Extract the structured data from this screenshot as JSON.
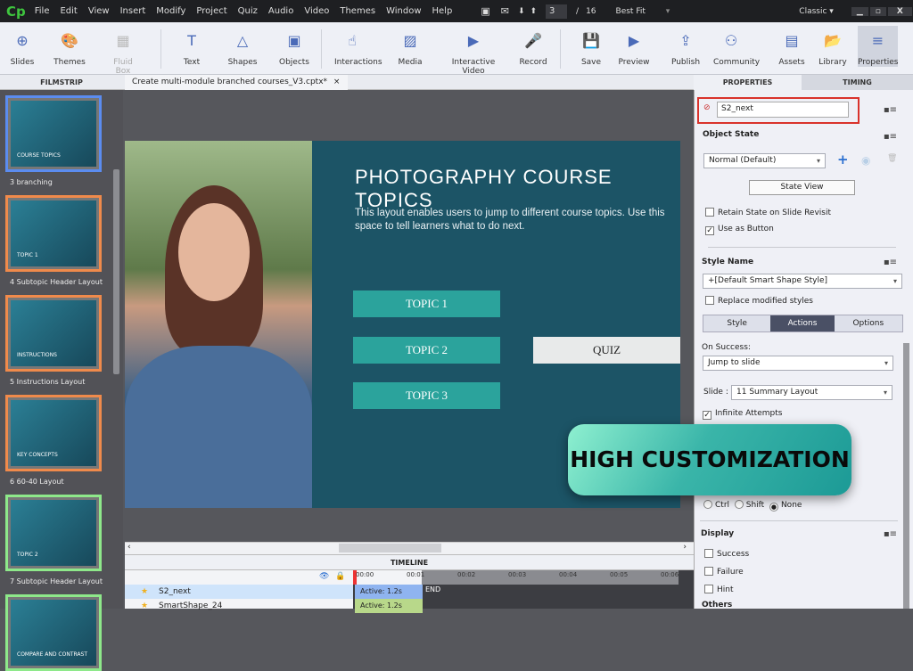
{
  "app": {
    "logo": "Cp",
    "menu": [
      "File",
      "Edit",
      "View",
      "Insert",
      "Modify",
      "Project",
      "Quiz",
      "Audio",
      "Video",
      "Themes",
      "Window",
      "Help"
    ],
    "current_page": "3",
    "page_sep": "/",
    "total_pages": "16",
    "zoom": "Best Fit",
    "workspace": "Classic"
  },
  "toolbar": [
    {
      "label": "Slides",
      "icon": "plus-circle-icon",
      "glyph": "⊕"
    },
    {
      "label": "Themes",
      "icon": "palette-icon",
      "glyph": "🎨"
    },
    {
      "label": "Fluid Box",
      "icon": "fluid-box-icon",
      "glyph": "▦",
      "disabled": true
    },
    {
      "label": "Text",
      "icon": "text-icon",
      "glyph": "T"
    },
    {
      "label": "Shapes",
      "icon": "shapes-icon",
      "glyph": "△"
    },
    {
      "label": "Objects",
      "icon": "objects-icon",
      "glyph": "▣"
    },
    {
      "label": "Interactions",
      "icon": "hand-pointer-icon",
      "glyph": "☝"
    },
    {
      "label": "Media",
      "icon": "image-icon",
      "glyph": "▨"
    },
    {
      "label": "Interactive Video",
      "icon": "video-icon",
      "glyph": "▶"
    },
    {
      "label": "Record",
      "icon": "microphone-icon",
      "glyph": "🎤"
    },
    {
      "label": "Save",
      "icon": "save-icon",
      "glyph": "💾"
    },
    {
      "label": "Preview",
      "icon": "play-icon",
      "glyph": "▶"
    },
    {
      "label": "Publish",
      "icon": "publish-icon",
      "glyph": "⇪"
    },
    {
      "label": "Community",
      "icon": "community-icon",
      "glyph": "⚇"
    },
    {
      "label": "Assets",
      "icon": "assets-icon",
      "glyph": "▤"
    },
    {
      "label": "Library",
      "icon": "library-icon",
      "glyph": "📂"
    },
    {
      "label": "Properties",
      "icon": "properties-icon",
      "glyph": "≡"
    }
  ],
  "panels": {
    "filmstrip": "FILMSTRIP",
    "document_tab": "Create multi-module branched courses_V3.cptx*",
    "close": "×",
    "properties": "PROPERTIES",
    "timing": "TIMING"
  },
  "filmstrip": [
    {
      "label": "3 branching",
      "thumb_title": "COURSE TOPICS",
      "border": "#5b8cf0"
    },
    {
      "label": "4 Subtopic Header Layout",
      "thumb_title": "TOPIC 1",
      "border": "#f08a4b"
    },
    {
      "label": "5 Instructions Layout",
      "thumb_title": "INSTRUCTIONS",
      "border": "#f08a4b"
    },
    {
      "label": "6 60-40 Layout",
      "thumb_title": "KEY CONCEPTS",
      "border": "#f08a4b"
    },
    {
      "label": "7 Subtopic Header Layout",
      "thumb_title": "TOPIC 2",
      "border": "#8ee88a"
    },
    {
      "label": "",
      "thumb_title": "COMPARE AND CONTRAST",
      "border": "#8ee88a"
    }
  ],
  "slide": {
    "title": "PHOTOGRAPHY COURSE TOPICS",
    "body": "This layout enables users to jump to different course topics. Use this space to tell learners what to do next.",
    "topics": [
      "TOPIC 1",
      "TOPIC 2",
      "TOPIC 3"
    ],
    "quiz": "QUIZ"
  },
  "timeline": {
    "title": "TIMELINE",
    "ticks": [
      "00:00",
      "00:01",
      "00:02",
      "00:03",
      "00:04",
      "00:05",
      "00:06"
    ],
    "rows": [
      {
        "name": "S2_next",
        "bar": "Active: 1.2s"
      },
      {
        "name": "SmartShape_24",
        "bar": "Active: 1.2s"
      }
    ],
    "end": "END"
  },
  "properties": {
    "object_name": "S2_next",
    "object_state": "Object State",
    "state_value": "Normal (Default)",
    "state_view": "State View",
    "retain_state": "Retain State on Slide Revisit",
    "use_as_button": "Use as Button",
    "style_name": "Style Name",
    "style_value": "+[Default Smart Shape Style]",
    "replace_styles": "Replace modified styles",
    "tabs": [
      "Style",
      "Actions",
      "Options"
    ],
    "on_success": "On Success:",
    "action": "Jump to slide",
    "slide_label": "Slide :",
    "slide_value": "11 Summary Layout",
    "infinite_attempts": "Infinite Attempts",
    "modifiers": [
      "Ctrl",
      "Shift",
      "None"
    ],
    "display": "Display",
    "display_items": [
      "Success",
      "Failure",
      "Hint"
    ],
    "others": "Others"
  },
  "overlay": {
    "text": "HIGH CUSTOMIZATION"
  }
}
